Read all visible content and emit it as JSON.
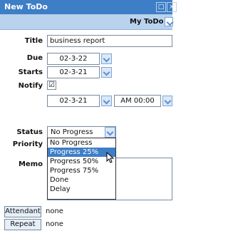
{
  "window": {
    "title": "New ToDo"
  },
  "header": {
    "owner": "My ToDo"
  },
  "form": {
    "title_label": "Title",
    "title_value": "business report",
    "due_label": "Due",
    "due_value": "02-3-22",
    "starts_label": "Starts",
    "starts_value": "02-3-21",
    "notify_label": "Notify",
    "notify_checked": "☑",
    "notify_date": "02-3-21",
    "notify_time": "AM 00:00",
    "status_label": "Status",
    "status_value": "No Progress",
    "priority_label": "Priority",
    "memo_label": "Memo"
  },
  "status_options": [
    "No Progress",
    "Progress 25%",
    "Progress 50%",
    "Progress 75%",
    "Done",
    "Delay"
  ],
  "footer": {
    "attendant_label": "Attendant",
    "attendant_value": "none",
    "repeat_label": "Repeat",
    "repeat_value": "none"
  },
  "colors": {
    "accent": "#3d7ec6",
    "subbar": "#b9d2ee"
  }
}
